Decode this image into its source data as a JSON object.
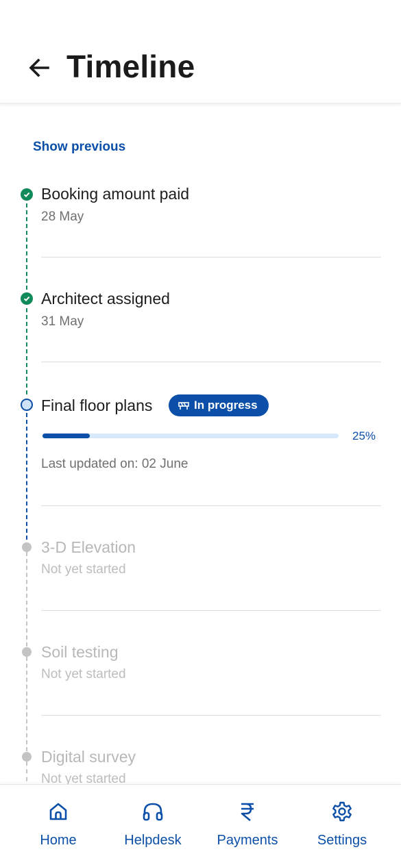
{
  "header": {
    "title": "Timeline",
    "back_icon": "arrow-left-icon"
  },
  "show_previous": "Show previous",
  "timeline": [
    {
      "title": "Booking amount paid",
      "subtitle": "28 May",
      "status": "done"
    },
    {
      "title": "Architect assigned",
      "subtitle": "31 May",
      "status": "done"
    },
    {
      "title": "Final floor plans",
      "status": "in_progress",
      "badge": "In progress",
      "progress_percent": 25,
      "progress_label": "25%",
      "subtitle": "Last updated on: 02 June"
    },
    {
      "title": "3-D Elevation",
      "subtitle": "Not yet started",
      "status": "pending"
    },
    {
      "title": "Soil testing",
      "subtitle": "Not yet started",
      "status": "pending"
    },
    {
      "title": "Digital survey",
      "subtitle": "Not yet started",
      "status": "pending"
    }
  ],
  "bottom_nav": [
    {
      "label": "Home",
      "icon": "home-icon"
    },
    {
      "label": "Helpdesk",
      "icon": "headphones-icon"
    },
    {
      "label": "Payments",
      "icon": "rupee-icon"
    },
    {
      "label": "Settings",
      "icon": "gear-icon"
    }
  ],
  "colors": {
    "accent": "#0b4fa8",
    "done": "#118a5c",
    "pending": "#c4c4c4",
    "progress_track": "#d8e8fb"
  }
}
